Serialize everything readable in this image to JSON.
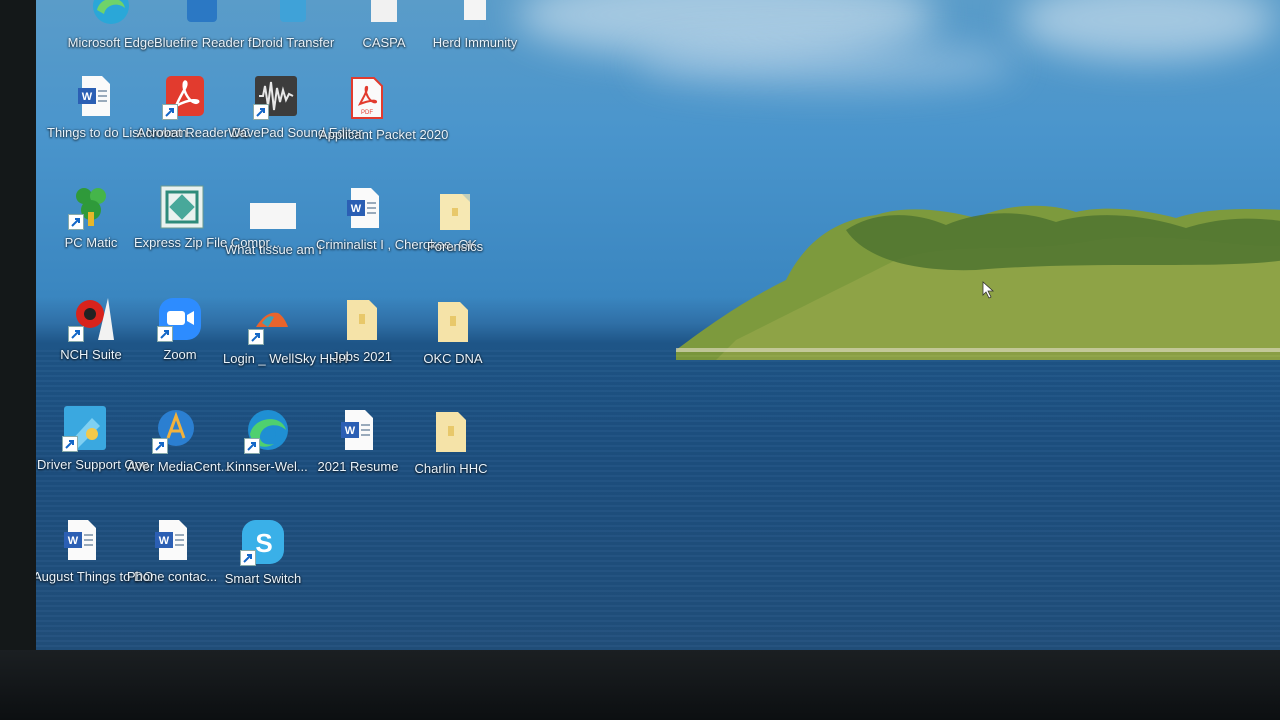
{
  "desktop": {
    "icons": [
      {
        "name": "Microsoft Edge",
        "label": "Microsoft Edge",
        "icon": "edge-icon"
      },
      {
        "name": "Bluefire Reader",
        "label": "Bluefire Reader f...",
        "icon": "bluefire-icon"
      },
      {
        "name": "Droid Transfer",
        "label": "Droid Transfer",
        "icon": "droid-transfer-icon"
      },
      {
        "name": "CASPA",
        "label": "CASPA",
        "icon": "caspa-icon"
      },
      {
        "name": "Herd Immunity",
        "label": "Herd Immunity",
        "icon": "document-icon"
      },
      {
        "name": "Things to do List November",
        "label": "Things to do List Novem...",
        "icon": "word-document-icon"
      },
      {
        "name": "Acrobat Reader DC",
        "label": "Acrobat Reader DC",
        "icon": "acrobat-icon"
      },
      {
        "name": "WavePad Sound Editor",
        "label": "WavePad Sound Editor",
        "icon": "wavepad-icon"
      },
      {
        "name": "Applicant Packet 2020",
        "label": "Applicant Packet 2020",
        "icon": "pdf-icon"
      },
      {
        "name": "PC Matic",
        "label": "PC Matic",
        "icon": "pc-matic-icon"
      },
      {
        "name": "Express Zip File Compressor",
        "label": "Express Zip File Compr...",
        "icon": "express-zip-icon"
      },
      {
        "name": "What tissue am I",
        "label": "What tissue am I",
        "icon": "blank-file-icon"
      },
      {
        "name": "Criminalist I, Cherokee, OK",
        "label": "Criminalist I , Cherokee, OK",
        "icon": "word-document-icon"
      },
      {
        "name": "Forensics",
        "label": "Forensics",
        "icon": "folder-icon"
      },
      {
        "name": "NCH Suite",
        "label": "NCH Suite",
        "icon": "nch-suite-icon"
      },
      {
        "name": "Zoom",
        "label": "Zoom",
        "icon": "zoom-icon"
      },
      {
        "name": "Login WellSky HHH",
        "label": "Login _ WellSky HHH",
        "icon": "wellsky-icon"
      },
      {
        "name": "Jobs 2021",
        "label": "Jobs 2021",
        "icon": "folder-icon"
      },
      {
        "name": "OKC DNA",
        "label": "OKC DNA",
        "icon": "folder-icon"
      },
      {
        "name": "Driver Support One",
        "label": "Driver Support One",
        "icon": "driver-support-icon"
      },
      {
        "name": "AVer MediaCenter",
        "label": "AVer MediaCent...",
        "icon": "aver-icon"
      },
      {
        "name": "Kinnser-Wel",
        "label": "Kinnser-Wel...",
        "icon": "edge-icon"
      },
      {
        "name": "2021 Resume",
        "label": "2021 Resume",
        "icon": "word-document-icon"
      },
      {
        "name": "Charlin HHC",
        "label": "Charlin HHC",
        "icon": "folder-icon"
      },
      {
        "name": "August Things to DO",
        "label": "August Things to DO",
        "icon": "word-document-icon"
      },
      {
        "name": "Phone contacts",
        "label": "Phone contac...",
        "icon": "word-document-icon"
      },
      {
        "name": "Smart Switch",
        "label": "Smart Switch",
        "icon": "smart-switch-icon"
      }
    ]
  },
  "colors": {
    "sky": "#4a95cc",
    "sea": "#1d4f80",
    "island": "#7f9a3c",
    "label_text": "#e9f3fb"
  }
}
